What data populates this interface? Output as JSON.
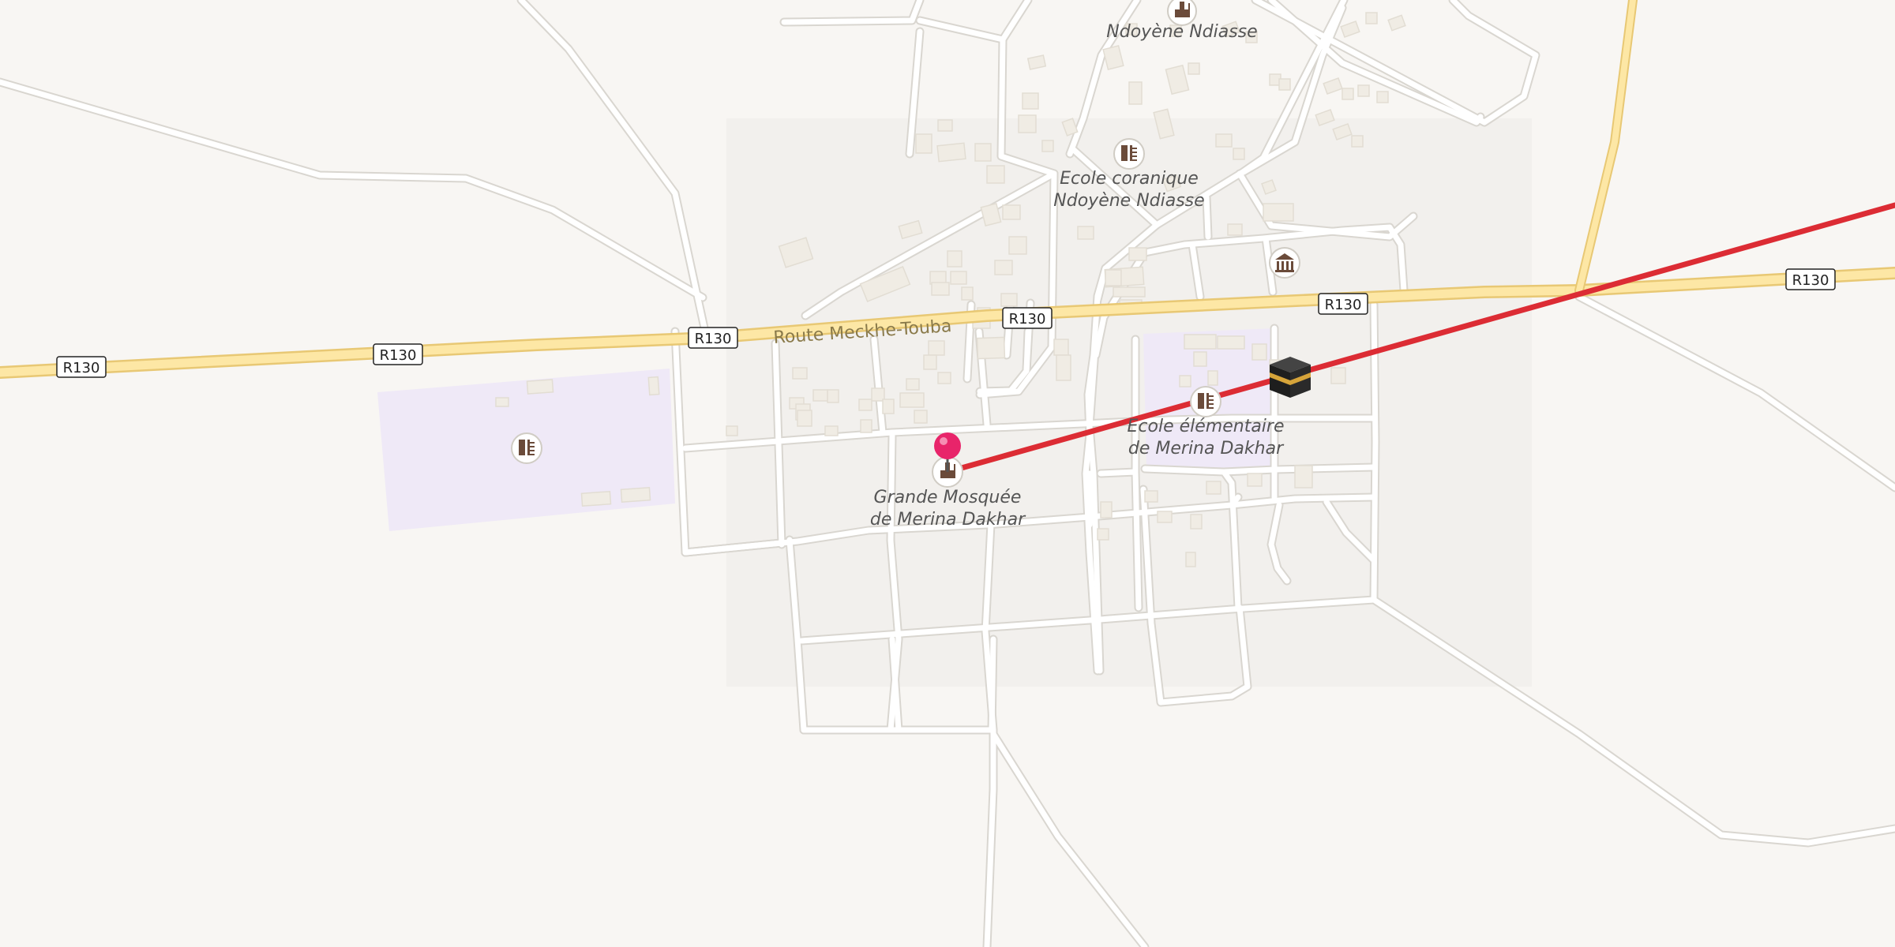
{
  "map": {
    "road_shield_label": "R130",
    "road_name": "Route Meckhe-Touba",
    "place_labels": {
      "village": "Ndoyène Ndiasse",
      "quranic_school_line1": "Ecole coranique",
      "quranic_school_line2": "Ndoyène Ndiasse",
      "primary_school_line1": "Ecole élémentaire",
      "primary_school_line2": "de Merina Dakhar",
      "mosque_line1": "Grande Mosquée",
      "mosque_line2": "de Merina Dakhar"
    },
    "icons": {
      "mosque": "mosque-icon",
      "school": "school-icon",
      "museum": "museum-icon",
      "kaaba": "kaaba-icon",
      "pin": "location-pin-icon"
    },
    "colors": {
      "background": "#f8f6f3",
      "road": "#ffffff",
      "road_outline": "#d9d6d0",
      "primary_road": "#fde7a5",
      "primary_road_outline": "#e8c874",
      "school_area": "#efe9f7",
      "building": "#f0ece4",
      "qibla_line": "#dc2c34",
      "pin": "#e8246a"
    }
  }
}
